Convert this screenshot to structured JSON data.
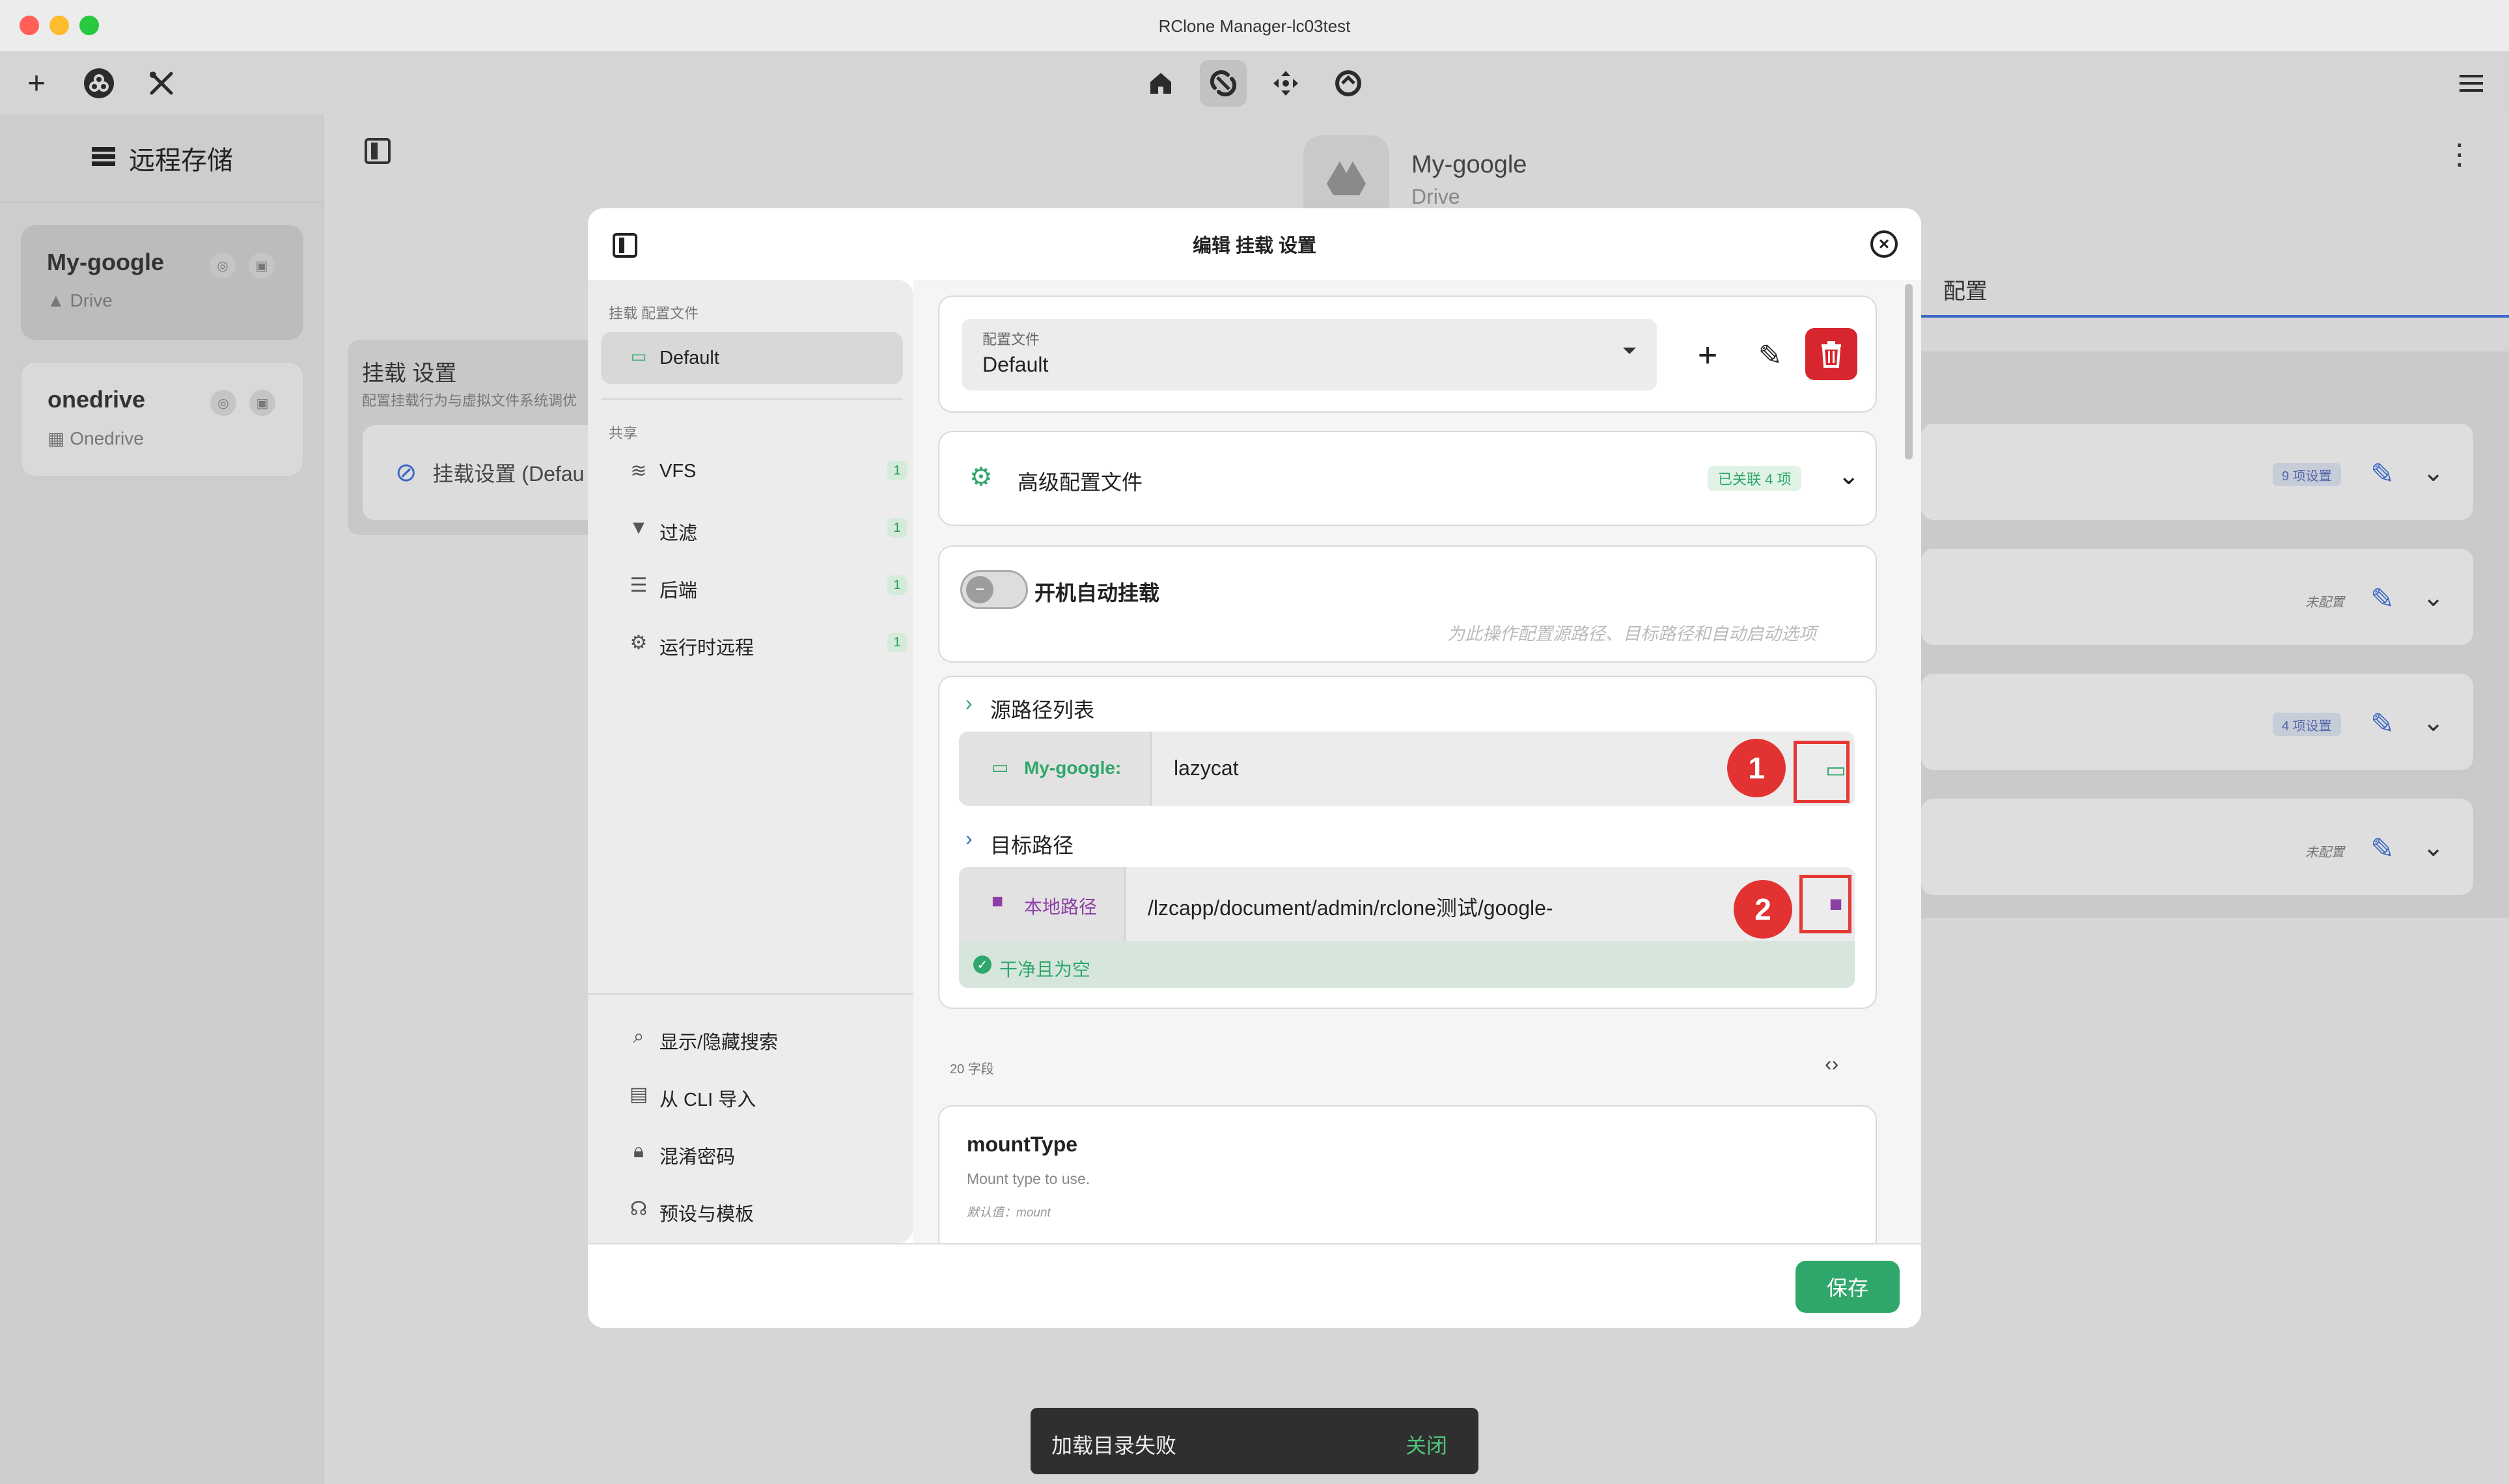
{
  "window": {
    "title": "RClone Manager-lc03test"
  },
  "toolbar": {
    "left_icons": [
      "plus-icon",
      "rclone-logo-icon",
      "tools-icon"
    ],
    "nav_icons": [
      "home-icon",
      "mount-icon",
      "transfer-icon",
      "sync-icon"
    ],
    "menu_icon": "hamburger-icon"
  },
  "sidebar": {
    "title": "远程存储",
    "remotes": [
      {
        "name": "My-google",
        "type": "Drive"
      },
      {
        "name": "onedrive",
        "type": "Onedrive"
      }
    ]
  },
  "main": {
    "remote_name": "My-google",
    "remote_type": "Drive",
    "tab_config": "配置",
    "section_title": "挂载 设置",
    "section_desc": "配置挂载行为与虚拟文件系统调优",
    "mount_item": "挂载设置 (Defau",
    "rows": [
      {
        "badge": "9 项设置"
      },
      {
        "badge": "未配置"
      },
      {
        "badge": "4 项设置"
      },
      {
        "badge": "未配置"
      }
    ]
  },
  "modal": {
    "title": "编辑 挂载 设置",
    "side": {
      "profiles_heading": "挂载 配置文件",
      "profile_default": "Default",
      "shared_heading": "共享",
      "shared_items": [
        {
          "label": "VFS",
          "count": "1"
        },
        {
          "label": "过滤",
          "count": "1"
        },
        {
          "label": "后端",
          "count": "1"
        },
        {
          "label": "运行时远程",
          "count": "1"
        }
      ],
      "bottom_items": [
        {
          "label": "显示/隐藏搜索"
        },
        {
          "label": "从 CLI 导入"
        },
        {
          "label": "混淆密码"
        },
        {
          "label": "预设与模板"
        }
      ]
    },
    "profile_select": {
      "label": "配置文件",
      "value": "Default"
    },
    "advanced": {
      "label": "高级配置文件",
      "badge": "已关联 4 项"
    },
    "autostart": {
      "label": "开机自动挂载",
      "hint": "为此操作配置源路径、目标路径和自动启动选项",
      "enabled": false
    },
    "source": {
      "heading": "源路径列表",
      "remote": "My-google:",
      "path": "lazycat"
    },
    "target": {
      "heading": "目标路径",
      "type": "本地路径",
      "path": "/lzcapp/document/admin/rclone测试/google-",
      "status": "干净且为空"
    },
    "fields_count": "20 字段",
    "field": {
      "name": "mountType",
      "desc": "Mount type to use.",
      "default": "默认值：mount"
    },
    "save": "保存"
  },
  "annotations": {
    "marker1": "1",
    "marker2": "2",
    "color": "#e53935"
  },
  "toast": {
    "message": "加载目录失败",
    "action": "关闭"
  },
  "colors": {
    "accent_green": "#2fa76a",
    "danger_red": "#d7262e",
    "folder_purple": "#8e3fa6",
    "link_blue": "#3d68c6"
  }
}
